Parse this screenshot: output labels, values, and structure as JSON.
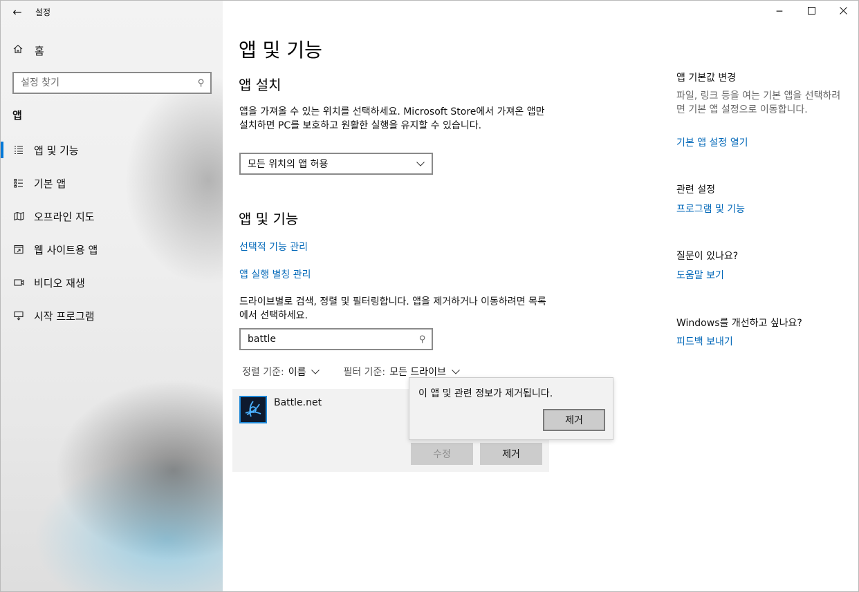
{
  "window": {
    "title": "설정"
  },
  "sidebar": {
    "home_label": "홈",
    "search_placeholder": "설정 찾기",
    "section_heading": "앱",
    "items": [
      {
        "label": "앱 및 기능",
        "icon": "apps-features-icon",
        "active": true
      },
      {
        "label": "기본 앱",
        "icon": "default-apps-icon",
        "active": false
      },
      {
        "label": "오프라인 지도",
        "icon": "offline-maps-icon",
        "active": false
      },
      {
        "label": "웹 사이트용 앱",
        "icon": "apps-for-websites-icon",
        "active": false
      },
      {
        "label": "비디오 재생",
        "icon": "video-playback-icon",
        "active": false
      },
      {
        "label": "시작 프로그램",
        "icon": "startup-icon",
        "active": false
      }
    ]
  },
  "main": {
    "title": "앱 및 기능",
    "install": {
      "heading": "앱 설치",
      "description": "앱을 가져올 수 있는 위치를 선택하세요. Microsoft Store에서 가져온 앱만 설치하면 PC를 보호하고 원활한 실행을 유지할 수 있습니다.",
      "dropdown_value": "모든 위치의 앱 허용"
    },
    "apps": {
      "heading": "앱 및 기능",
      "link_optional": "선택적 기능 관리",
      "link_aliases": "앱 실행 별칭 관리",
      "description": "드라이브별로 검색, 정렬 및 필터링합니다. 앱을 제거하거나 이동하려면 목록에서 선택하세요.",
      "search_value": "battle",
      "sort_key": "정렬 기준:",
      "sort_value": "이름",
      "filter_key": "필터 기준:",
      "filter_value": "모든 드라이브"
    },
    "app_item": {
      "name": "Battle.net",
      "modify_label": "수정",
      "uninstall_label": "제거"
    },
    "flyout": {
      "message": "이 앱 및 관련 정보가 제거됩니다.",
      "confirm_label": "제거"
    }
  },
  "right": {
    "default_apps_heading": "앱 기본값 변경",
    "default_apps_text": "파일, 링크 등을 여는 기본 앱을 선택하려면 기본 앱 설정으로 이동합니다.",
    "default_apps_link": "기본 앱 설정 열기",
    "related_heading": "관련 설정",
    "related_link": "프로그램 및 기능",
    "question_heading": "질문이 있나요?",
    "help_link": "도움말 보기",
    "improve_heading": "Windows를 개선하고 싶나요?",
    "feedback_link": "피드백 보내기"
  }
}
